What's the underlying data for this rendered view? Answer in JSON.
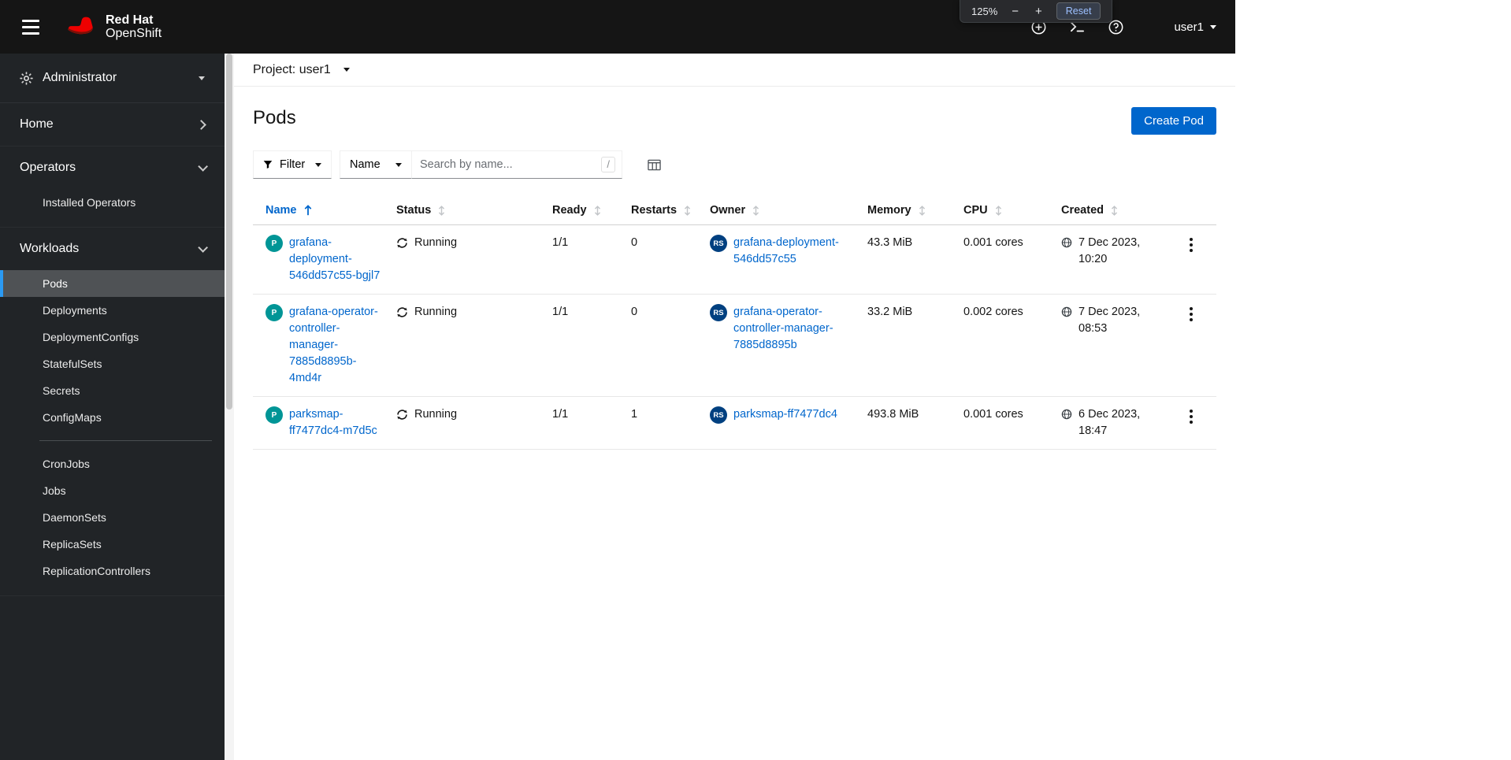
{
  "masthead": {
    "brand": {
      "top": "Red Hat",
      "bottom": "OpenShift"
    },
    "icons": [
      {
        "name": "quick-create",
        "glyph": "plus-circle"
      },
      {
        "name": "web-terminal",
        "glyph": "terminal-prompt"
      },
      {
        "name": "help",
        "glyph": "question-circle"
      }
    ],
    "user_menu": {
      "label": "user1"
    }
  },
  "zoom_popup": {
    "level": "125%",
    "minus": "−",
    "plus": "+",
    "reset": "Reset"
  },
  "sidebar": {
    "perspective": {
      "label": "Administrator"
    },
    "sections": [
      {
        "label": "Home",
        "expanded": false,
        "items": []
      },
      {
        "label": "Operators",
        "expanded": true,
        "items": [
          "Installed Operators"
        ]
      },
      {
        "label": "Workloads",
        "expanded": true,
        "selected_item": "Pods",
        "items": [
          "Pods",
          "Deployments",
          "DeploymentConfigs",
          "StatefulSets",
          "Secrets",
          "ConfigMaps",
          "CronJobs",
          "Jobs",
          "DaemonSets",
          "ReplicaSets",
          "ReplicationControllers"
        ]
      }
    ]
  },
  "project_bar": {
    "label": "Project: user1"
  },
  "page": {
    "title": "Pods",
    "primary_action": "Create Pod"
  },
  "toolbar": {
    "filter": {
      "label": "Filter"
    },
    "attribute": {
      "selected": "Name"
    },
    "search": {
      "placeholder": "Search by name...",
      "shortcut": "/"
    }
  },
  "table": {
    "columns": [
      "Name",
      "Status",
      "Ready",
      "Restarts",
      "Owner",
      "Memory",
      "CPU",
      "Created"
    ],
    "sort": {
      "column": "Name",
      "direction": "ascending"
    },
    "rows": [
      {
        "badge": "P",
        "name": "grafana-deployment-546dd57c55-bgjl7",
        "status": "Running",
        "ready": "1/1",
        "restarts": "0",
        "owner_badge": "RS",
        "owner": "grafana-deployment-546dd57c55",
        "memory": "43.3 MiB",
        "cpu": "0.001 cores",
        "created": {
          "date": "7 Dec 2023,",
          "time": "10:20"
        }
      },
      {
        "badge": "P",
        "name": "grafana-operator-controller-manager-7885d8895b-4md4r",
        "status": "Running",
        "ready": "1/1",
        "restarts": "0",
        "owner_badge": "RS",
        "owner": "grafana-operator-controller-manager-7885d8895b",
        "memory": "33.2 MiB",
        "cpu": "0.002 cores",
        "created": {
          "date": "7 Dec 2023,",
          "time": "08:53"
        }
      },
      {
        "badge": "P",
        "name": "parksmap-ff7477dc4-m7d5c",
        "status": "Running",
        "ready": "1/1",
        "restarts": "1",
        "owner_badge": "RS",
        "owner": "parksmap-ff7477dc4",
        "memory": "493.8 MiB",
        "cpu": "0.001 cores",
        "created": {
          "date": "6 Dec 2023,",
          "time": "18:47"
        }
      }
    ]
  },
  "colors": {
    "accent": "#0066cc",
    "brand_red": "#ee0000",
    "masthead_bg": "#151515",
    "sidebar_bg": "#212427",
    "nav_selected_bg": "#4f5255",
    "nav_selected_border": "#2b9af3",
    "pod_badge": "#009596",
    "replicaset_badge": "#004080",
    "link": "#0066cc"
  }
}
